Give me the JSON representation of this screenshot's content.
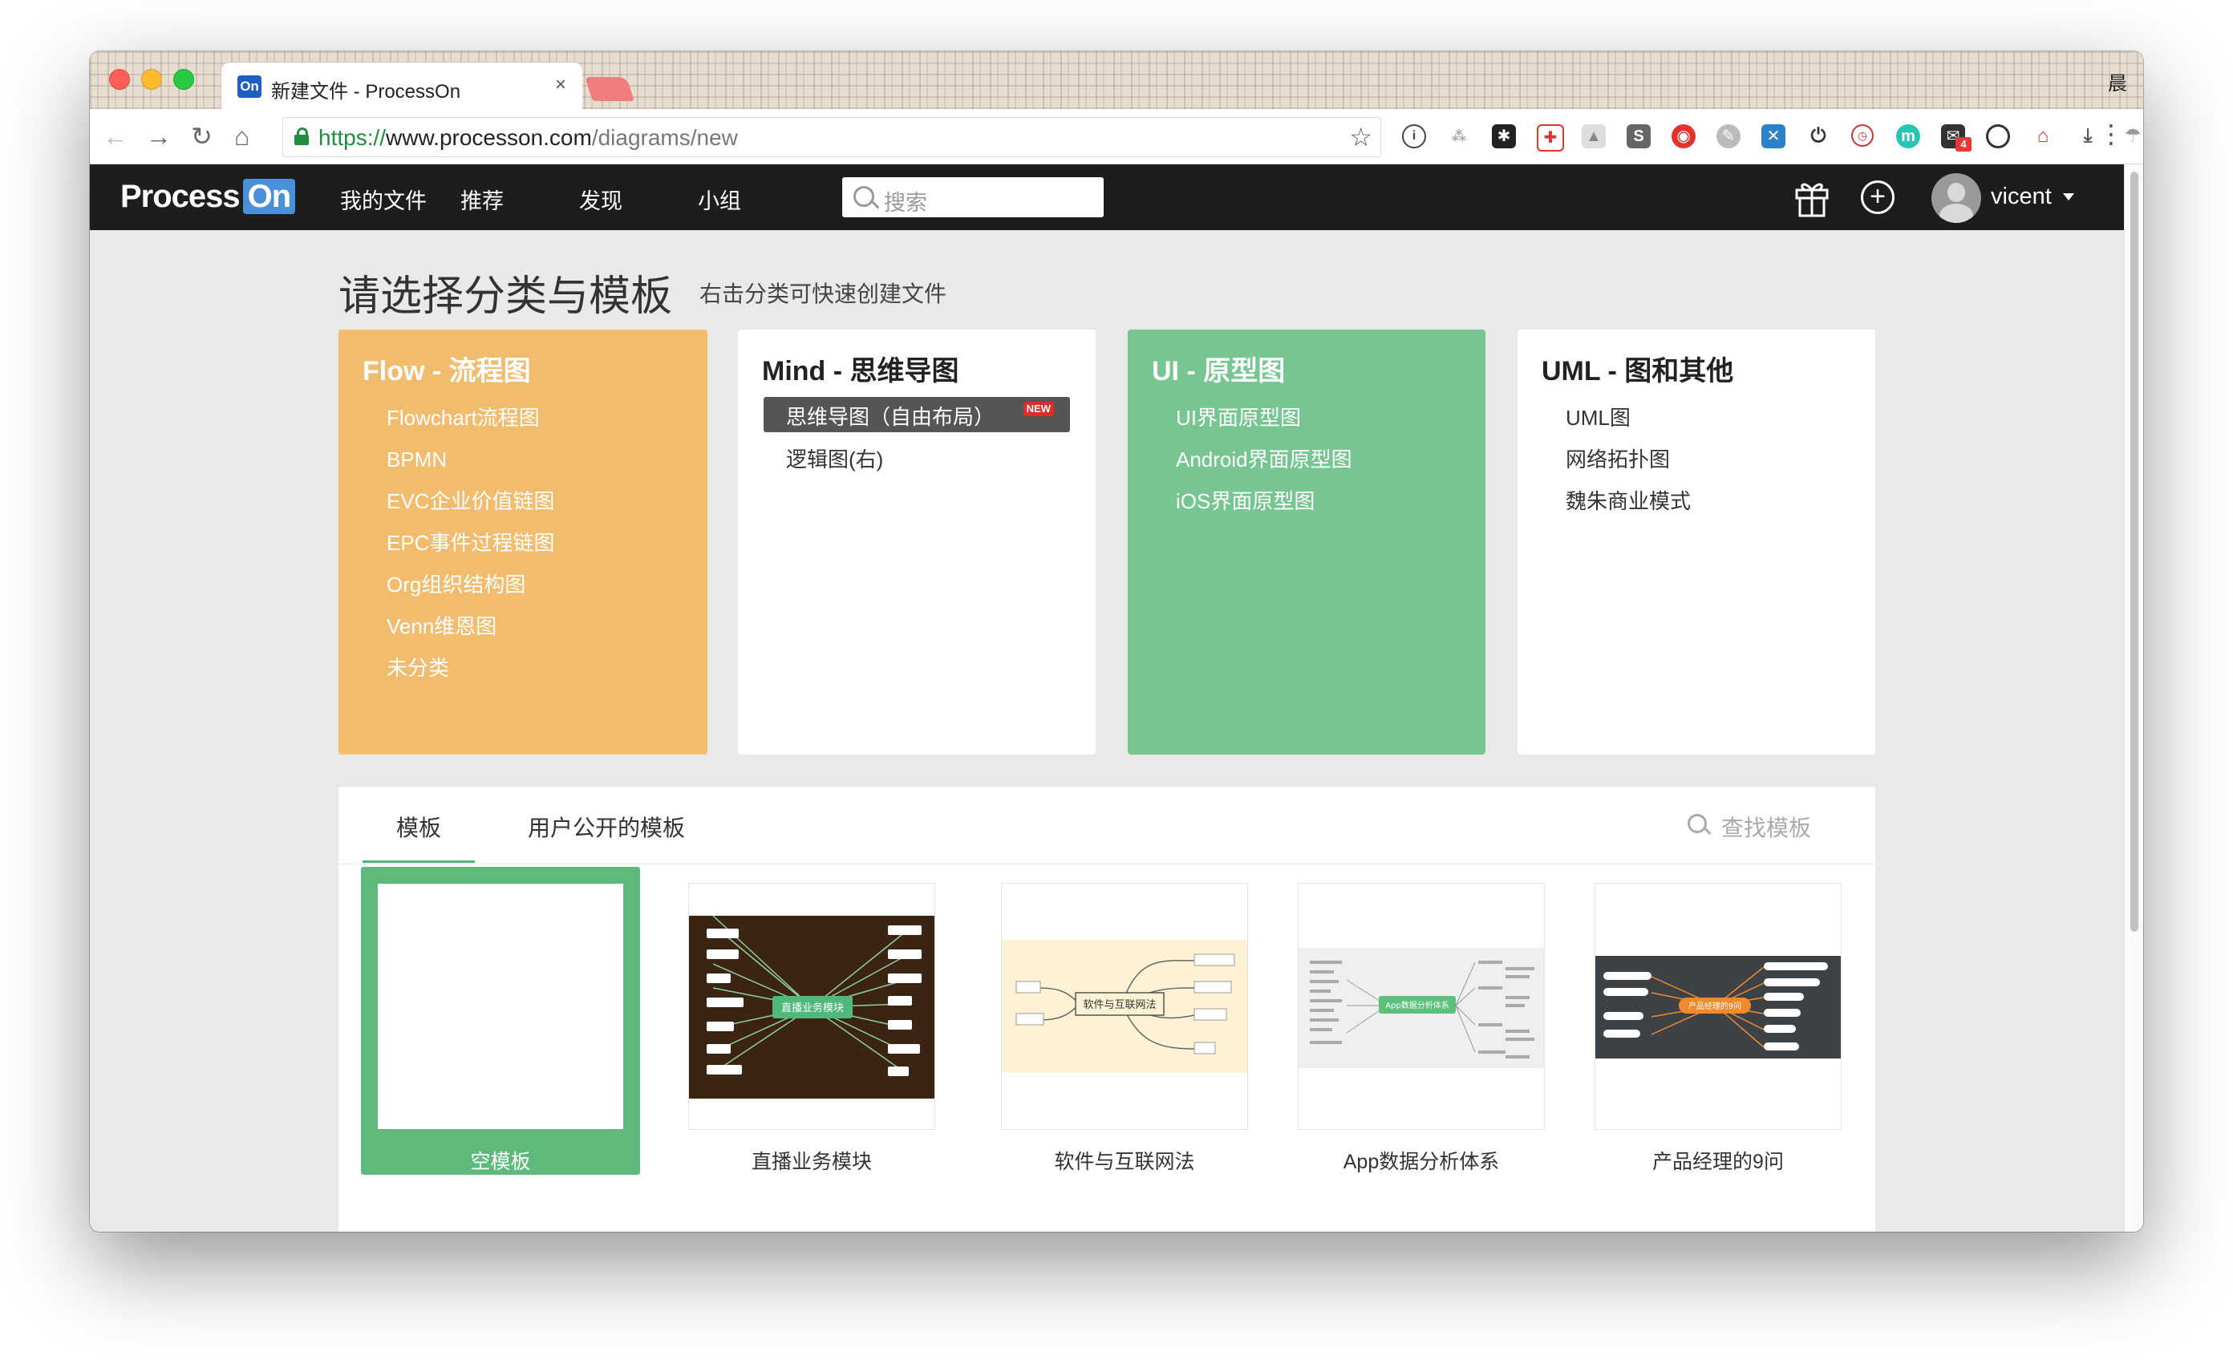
{
  "browser": {
    "tab_title": "新建文件 - ProcessOn",
    "tab_favicon": "On",
    "tab_close": "×",
    "user_badge": "晨",
    "url_scheme": "https://",
    "url_host": "www.processon.com",
    "url_path": "/diagrams/new",
    "nav_back": "←",
    "nav_forward": "→",
    "nav_reload": "↻",
    "nav_home": "⌂",
    "bookmark_star": "☆",
    "menu": "⋮",
    "extension_badge": "4"
  },
  "navbar": {
    "logo_a": "Process",
    "logo_b": "On",
    "links": [
      "我的文件",
      "推荐",
      "发现",
      "小组"
    ],
    "search_placeholder": "搜索",
    "username": "vicent"
  },
  "header": {
    "title": "请选择分类与模板",
    "subtitle": "右击分类可快速创建文件"
  },
  "categories": [
    {
      "title": "Flow - 流程图",
      "items": [
        "Flowchart流程图",
        "BPMN",
        "EVC企业价值链图",
        "EPC事件过程链图",
        "Org组织结构图",
        "Venn维恩图",
        "未分类"
      ]
    },
    {
      "title": "Mind - 思维导图",
      "selected_item": "思维导图（自由布局）",
      "selected_badge": "NEW",
      "items": [
        "逻辑图(右)"
      ]
    },
    {
      "title": "UI - 原型图",
      "items": [
        "UI界面原型图",
        "Android界面原型图",
        "iOS界面原型图"
      ]
    },
    {
      "title": "UML - 图和其他",
      "items": [
        "UML图",
        "网络拓扑图",
        "魏朱商业模式"
      ]
    }
  ],
  "templates": {
    "tabs": [
      "模板",
      "用户公开的模板"
    ],
    "search_label": "查找模板",
    "items": [
      {
        "label": "空模板",
        "selected": true
      },
      {
        "label": "直播业务模块",
        "center": "直播业务模块"
      },
      {
        "label": "软件与互联网法",
        "center": "软件与互联网法"
      },
      {
        "label": "App数据分析体系",
        "center": "App数据分析体系"
      },
      {
        "label": "产品经理的9问",
        "center": "产品经理的9问"
      }
    ]
  },
  "colors": {
    "flow": "#f2bc6f",
    "ui": "#77c692",
    "accent_green": "#5dba7a",
    "navbar": "#1d1d1d"
  }
}
